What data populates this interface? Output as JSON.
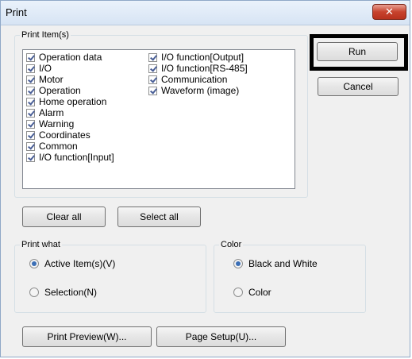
{
  "window": {
    "title": "Print",
    "close_label": "✕"
  },
  "print_items": {
    "label": "Print Item(s)",
    "column1": [
      {
        "label": "Operation data",
        "checked": true
      },
      {
        "label": "I/O",
        "checked": true
      },
      {
        "label": "Motor",
        "checked": true
      },
      {
        "label": "Operation",
        "checked": true
      },
      {
        "label": "Home operation",
        "checked": true
      },
      {
        "label": "Alarm",
        "checked": true
      },
      {
        "label": "Warning",
        "checked": true
      },
      {
        "label": "Coordinates",
        "checked": true
      },
      {
        "label": "Common",
        "checked": true
      },
      {
        "label": "I/O function[Input]",
        "checked": true
      }
    ],
    "column2": [
      {
        "label": "I/O function[Output]",
        "checked": true
      },
      {
        "label": "I/O function[RS-485]",
        "checked": true
      },
      {
        "label": "Communication",
        "checked": true
      },
      {
        "label": "Waveform (image)",
        "checked": true
      }
    ]
  },
  "buttons": {
    "run": "Run",
    "cancel": "Cancel",
    "clear_all": "Clear all",
    "select_all": "Select all",
    "print_preview": "Print Preview(W)...",
    "page_setup": "Page Setup(U)..."
  },
  "print_what": {
    "label": "Print what",
    "options": [
      {
        "label": "Active Item(s)(V)",
        "selected": true
      },
      {
        "label": "Selection(N)",
        "selected": false
      }
    ]
  },
  "color": {
    "label": "Color",
    "options": [
      {
        "label": "Black and White",
        "selected": true
      },
      {
        "label": "Color",
        "selected": false
      }
    ]
  }
}
